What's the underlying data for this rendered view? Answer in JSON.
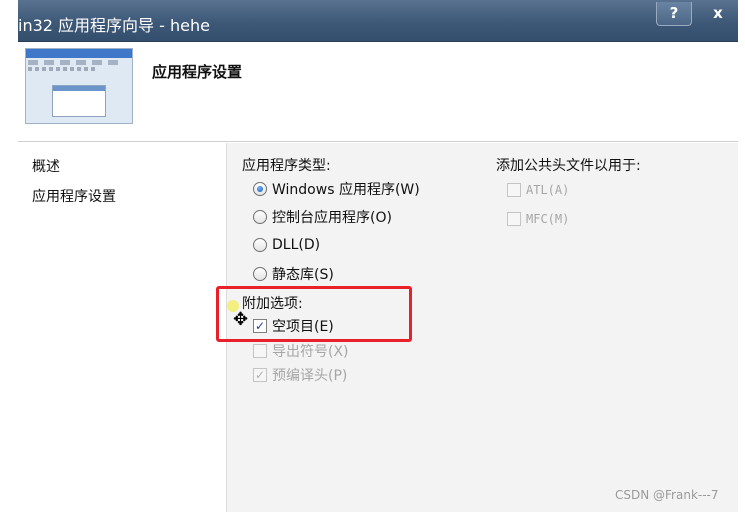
{
  "window": {
    "title": "in32 应用程序向导 - hehe",
    "help_label": "?",
    "close_label": "x"
  },
  "header": {
    "section_title": "应用程序设置"
  },
  "nav": {
    "items": [
      "概述",
      "应用程序设置"
    ]
  },
  "app_type": {
    "label": "应用程序类型:",
    "options": [
      {
        "label": "Windows 应用程序(W)",
        "selected": true
      },
      {
        "label": "控制台应用程序(O)",
        "selected": false
      },
      {
        "label": "DLL(D)",
        "selected": false
      },
      {
        "label": "静态库(S)",
        "selected": false
      }
    ]
  },
  "extra_options": {
    "label": "附加选项:",
    "items": [
      {
        "label": "空项目(E)",
        "checked": true,
        "enabled": true
      },
      {
        "label": "导出符号(X)",
        "checked": false,
        "enabled": false
      },
      {
        "label": "预编译头(P)",
        "checked": true,
        "enabled": false
      }
    ]
  },
  "common_headers": {
    "label": "添加公共头文件以用于:",
    "items": [
      {
        "label": "ATL(A)",
        "checked": false,
        "enabled": false
      },
      {
        "label": "MFC(M)",
        "checked": false,
        "enabled": false
      }
    ]
  },
  "watermark": "CSDN @Frank---7",
  "icons": {
    "check_glyph": "✓",
    "cursor_glyph": "✥"
  },
  "colors": {
    "highlight": "#e8202a",
    "titlebar": "#3e5878"
  }
}
